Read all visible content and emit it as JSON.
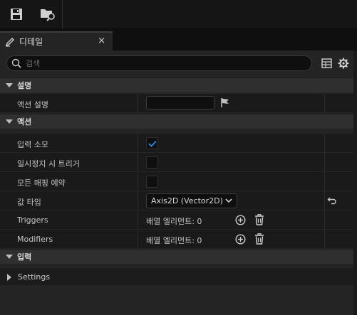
{
  "toolbar": {
    "save_icon": "save-icon",
    "browse_icon": "browse-folder-icon"
  },
  "tab": {
    "label": "디테일",
    "icon": "pencil-icon",
    "close_label": "×"
  },
  "search": {
    "placeholder": "검색"
  },
  "sections": {
    "description": {
      "label": "설명"
    },
    "action": {
      "label": "액션"
    },
    "input": {
      "label": "입력"
    },
    "settings": {
      "label": "Settings"
    }
  },
  "rows": {
    "action_description": {
      "label": "액션 설명",
      "value": ""
    },
    "consume_input": {
      "label": "입력 소모",
      "checked": true
    },
    "trigger_when_paused": {
      "label": "일시정지 시 트리거",
      "checked": false
    },
    "reserve_all_mappings": {
      "label": "모든 매핑 예약",
      "checked": false
    },
    "value_type": {
      "label": "값 타입",
      "value": "Axis2D (Vector2D)"
    },
    "triggers": {
      "label": "Triggers",
      "value": "배열 엘리먼트: 0"
    },
    "modifiers": {
      "label": "Modifiers",
      "value": "배열 엘리먼트: 0"
    }
  },
  "colors": {
    "accent_check": "#2a7fd4",
    "panel_bg": "#242424",
    "row_bg": "#1a1a1a",
    "section_bg": "#2f2f2f"
  }
}
